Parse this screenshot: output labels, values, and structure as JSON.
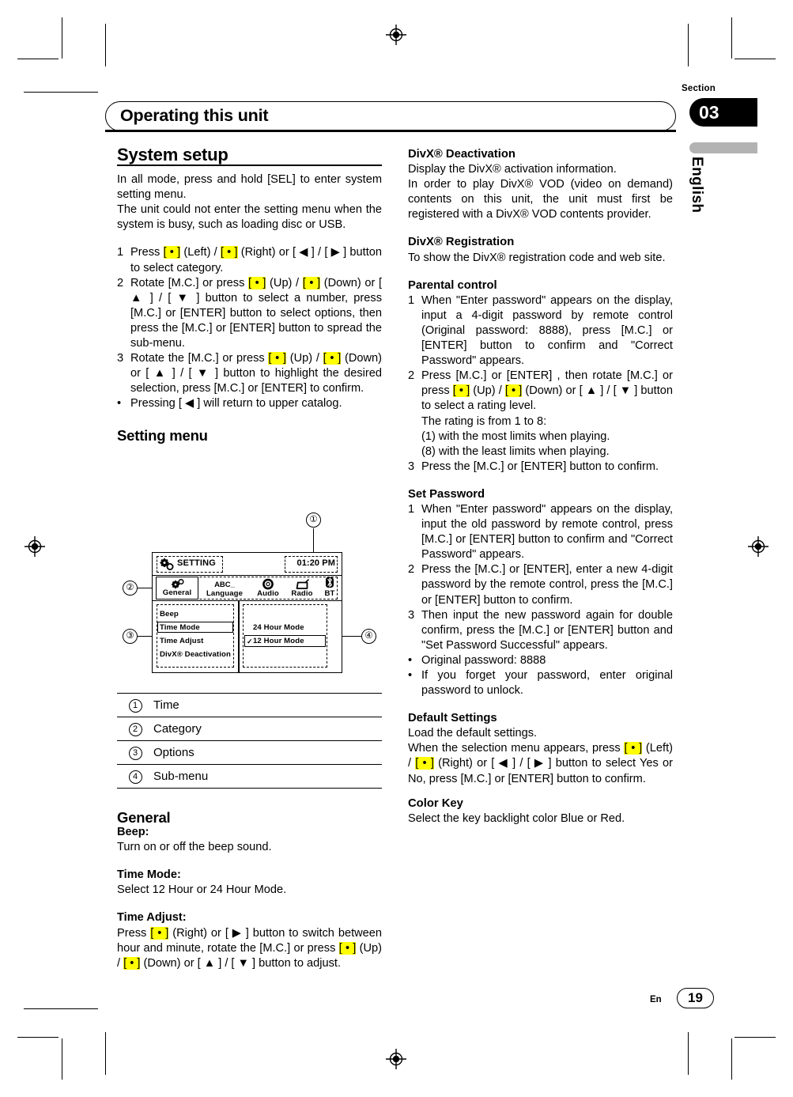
{
  "header": {
    "chapter_title": "Operating this unit",
    "section_label": "Section",
    "section_number": "03",
    "language_tab": "English"
  },
  "footer": {
    "language_code": "En",
    "page_number": "19"
  },
  "left_column": {
    "system_setup": {
      "heading": "System setup",
      "intro_1": "In all mode, press and hold [SEL] to enter system setting menu.",
      "intro_2": "The unit could not enter the setting menu when the system is busy, such as loading disc or USB.",
      "steps": [
        {
          "num": "1",
          "segments": [
            {
              "t": "Press "
            },
            {
              "t": "[ • ]",
              "hl": true
            },
            {
              "t": " (Left) / "
            },
            {
              "t": "[ • ]",
              "hl": true
            },
            {
              "t": " (Right) or [ ◀ ] / [ ▶ ] button to select category."
            }
          ]
        },
        {
          "num": "2",
          "segments": [
            {
              "t": "Rotate [M.C.] or press "
            },
            {
              "t": "[ • ]",
              "hl": true
            },
            {
              "t": " (Up) / "
            },
            {
              "t": "[ • ]",
              "hl": true
            },
            {
              "t": " (Down) or [ ▲ ] / [ ▼ ] button to select a number, press [M.C.] or [ENTER] button to select options, then press the [M.C.] or [ENTER] button to spread the sub-menu."
            }
          ]
        },
        {
          "num": "3",
          "segments": [
            {
              "t": "Rotate the [M.C.] or press "
            },
            {
              "t": "[ • ]",
              "hl": true
            },
            {
              "t": " (Up) / "
            },
            {
              "t": "[ • ]",
              "hl": true
            },
            {
              "t": " (Down) or [ ▲ ] / [ ▼ ] button to highlight the desired selection, press [M.C.] or [ENTER] to confirm."
            }
          ]
        }
      ],
      "bullet": "Pressing [ ◀ ] will return to upper catalog."
    },
    "setting_menu": {
      "heading": "Setting menu",
      "legend_rows": [
        {
          "num": "①",
          "digit": "1",
          "label": "Time"
        },
        {
          "num": "②",
          "digit": "2",
          "label": "Category"
        },
        {
          "num": "③",
          "digit": "3",
          "label": "Options"
        },
        {
          "num": "④",
          "digit": "4",
          "label": "Sub-menu"
        }
      ]
    },
    "general": {
      "heading": "General",
      "entries": [
        {
          "title": "Beep:",
          "body": "Turn on or off the beep sound."
        },
        {
          "title": "Time Mode:",
          "body": "Select 12 Hour or 24 Hour Mode."
        }
      ],
      "time_adjust": {
        "title": "Time Adjust:",
        "segments": [
          {
            "t": "Press "
          },
          {
            "t": "[ • ]",
            "hl": true
          },
          {
            "t": " (Right) or [ ▶ ] button to switch between hour and minute, rotate the [M.C.] or press "
          },
          {
            "t": "[ • ]",
            "hl": true
          },
          {
            "t": " (Up) / "
          },
          {
            "t": "[ • ]",
            "hl": true
          },
          {
            "t": " (Down) or [ ▲ ] / [ ▼ ] button to adjust."
          }
        ]
      }
    }
  },
  "figure": {
    "title_bar": {
      "icon": "gears-icon",
      "label": "SETTING",
      "time": "01:20 PM"
    },
    "tabs": [
      {
        "label": "General",
        "icon": "gears-icon",
        "selected": true
      },
      {
        "label": "Language",
        "icon": "abc-icon",
        "selected": false
      },
      {
        "label": "Audio",
        "icon": "speaker-ring-icon",
        "selected": false
      },
      {
        "label": "Radio",
        "icon": "radio-icon",
        "selected": false
      },
      {
        "label": "BT",
        "icon": "bluetooth-icon",
        "selected": false
      }
    ],
    "options": [
      {
        "label": "Beep",
        "selected": false
      },
      {
        "label": "Time Mode",
        "selected": true
      },
      {
        "label": "Time Adjust",
        "selected": false
      },
      {
        "label": "DivX® Deactivation",
        "selected": false
      }
    ],
    "submenu": [
      {
        "label": "24 Hour Mode",
        "selected": false,
        "checked": false
      },
      {
        "label": "12 Hour Mode",
        "selected": true,
        "checked": true
      }
    ],
    "callouts": [
      {
        "id": "1",
        "glyph": "①",
        "target": "time"
      },
      {
        "id": "2",
        "glyph": "②",
        "target": "category"
      },
      {
        "id": "3",
        "glyph": "③",
        "target": "options"
      },
      {
        "id": "4",
        "glyph": "④",
        "target": "sub-menu"
      }
    ]
  },
  "right_column": {
    "divx_deactivation": {
      "heading": "DivX® Deactivation",
      "body_1": "Display the DivX® activation information.",
      "body_2": "In order to play DivX® VOD (video on demand) contents on this unit, the unit must first be registered with a DivX® VOD contents provider."
    },
    "divx_registration": {
      "heading": "DivX® Registration",
      "body": "To show the DivX® registration code and web site."
    },
    "parental_control": {
      "heading": "Parental control",
      "steps": [
        {
          "num": "1",
          "segments": [
            {
              "t": "When \"Enter password\" appears on the display, input a 4-digit password by remote control (Original password: 8888), press [M.C.] or [ENTER] button to confirm and \"Correct Password\" appears."
            }
          ]
        },
        {
          "num": "2",
          "segments": [
            {
              "t": "Press [M.C.] or [ENTER] , then rotate [M.C.] or press "
            },
            {
              "t": "[ • ]",
              "hl": true
            },
            {
              "t": " (Up) / "
            },
            {
              "t": "[ • ]",
              "hl": true
            },
            {
              "t": " (Down) or [ ▲ ] / [ ▼ ] button to select a rating level."
            }
          ],
          "sub_lines": [
            "The rating is from 1 to 8:",
            "(1) with the most limits when playing.",
            "(8) with the least limits when playing."
          ]
        },
        {
          "num": "3",
          "segments": [
            {
              "t": "Press the [M.C.] or [ENTER] button to confirm."
            }
          ]
        }
      ]
    },
    "set_password": {
      "heading": "Set Password",
      "steps": [
        {
          "num": "1",
          "segments": [
            {
              "t": "When \"Enter password\" appears on the display, input the old password by remote control, press [M.C.] or [ENTER] button to confirm and \"Correct Password\" appears."
            }
          ]
        },
        {
          "num": "2",
          "segments": [
            {
              "t": "Press the [M.C.] or [ENTER], enter a new 4-digit password by the remote control, press the [M.C.] or [ENTER] button to confirm."
            }
          ]
        },
        {
          "num": "3",
          "segments": [
            {
              "t": "Then input the new password again for double confirm, press the [M.C.] or [ENTER] button and \"Set Password Successful\" appears."
            }
          ]
        }
      ],
      "bullets": [
        "Original password: 8888",
        "If you forget your password, enter original password to unlock."
      ]
    },
    "default_settings": {
      "heading": "Default Settings",
      "body_1": "Load the default settings.",
      "segments": [
        {
          "t": "When the selection menu appears, press "
        },
        {
          "t": "[ • ]",
          "hl": true
        },
        {
          "t": " (Left) / "
        },
        {
          "t": "[ • ]",
          "hl": true
        },
        {
          "t": " (Right) or [ ◀ ] / [ ▶ ] button to select Yes or No, press [M.C.] or [ENTER] button to confirm."
        }
      ]
    },
    "color_key": {
      "heading": "Color Key",
      "body": "Select the key backlight color Blue or Red."
    }
  },
  "colors": {
    "highlight": "#ffff00",
    "section_block": "#000000",
    "language_bar": "#b3b3b3"
  }
}
